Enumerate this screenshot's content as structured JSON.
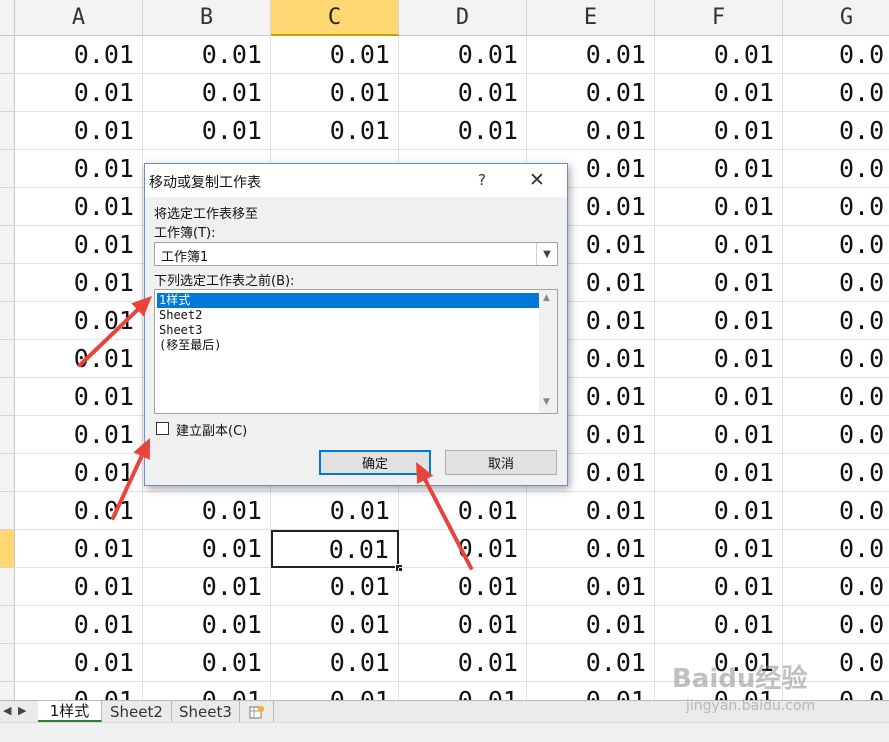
{
  "spreadsheet": {
    "columns": [
      "A",
      "B",
      "C",
      "D",
      "E",
      "F",
      "G"
    ],
    "active_column": "C",
    "active_row_index": 13,
    "cell_values": [
      [
        "0.01",
        "0.01",
        "0.01",
        "0.01",
        "0.01",
        "0.01",
        "0.0"
      ],
      [
        "0.01",
        "0.01",
        "0.01",
        "0.01",
        "0.01",
        "0.01",
        "0.0"
      ],
      [
        "0.01",
        "0.01",
        "0.01",
        "0.01",
        "0.01",
        "0.01",
        "0.0"
      ],
      [
        "0.01",
        "",
        "",
        "",
        "0.01",
        "0.01",
        "0.0"
      ],
      [
        "0.01",
        "",
        "",
        "",
        "0.01",
        "0.01",
        "0.0"
      ],
      [
        "0.01",
        "",
        "",
        "",
        "0.01",
        "0.01",
        "0.0"
      ],
      [
        "0.01",
        "",
        "",
        "",
        "0.01",
        "0.01",
        "0.0"
      ],
      [
        "0.01",
        "",
        "",
        "",
        "0.01",
        "0.01",
        "0.0"
      ],
      [
        "0.01",
        "",
        "",
        "",
        "0.01",
        "0.01",
        "0.0"
      ],
      [
        "0.01",
        "",
        "",
        "",
        "0.01",
        "0.01",
        "0.0"
      ],
      [
        "0.01",
        "",
        "",
        "",
        "0.01",
        "0.01",
        "0.0"
      ],
      [
        "0.01",
        "",
        "",
        "",
        "0.01",
        "0.01",
        "0.0"
      ],
      [
        "0.01",
        "0.01",
        "0.01",
        "0.01",
        "0.01",
        "0.01",
        "0.0"
      ],
      [
        "0.01",
        "0.01",
        "0.01",
        "0.01",
        "0.01",
        "0.01",
        "0.0"
      ],
      [
        "0.01",
        "0.01",
        "0.01",
        "0.01",
        "0.01",
        "0.01",
        "0.0"
      ],
      [
        "0.01",
        "0.01",
        "0.01",
        "0.01",
        "0.01",
        "0.01",
        "0.0"
      ],
      [
        "0.01",
        "0.01",
        "0.01",
        "0.01",
        "0.01",
        "0.01",
        "0.0"
      ],
      [
        "0.01",
        "0.01",
        "0.01",
        "0.01",
        "0.01",
        "0.01",
        "0.0"
      ]
    ]
  },
  "sheet_tabs": {
    "tabs": [
      "1样式",
      "Sheet2",
      "Sheet3"
    ],
    "active": "1样式",
    "new_sheet_icon": "insert-worksheet-icon"
  },
  "dialog": {
    "title": "移动或复制工作表",
    "help_label": "?",
    "close_label": "✕",
    "move_to_label": "将选定工作表移至",
    "workbook_label": "工作簿(T):",
    "workbook_value": "工作簿1",
    "before_sheet_label": "下列选定工作表之前(B):",
    "sheet_options": [
      "1样式",
      "Sheet2",
      "Sheet3",
      "(移至最后)"
    ],
    "selected_option": "1样式",
    "create_copy_label": "建立副本(C)",
    "create_copy_checked": false,
    "ok_label": "确定",
    "cancel_label": "取消"
  },
  "annotations": {
    "arrow_color": "#e8443c"
  },
  "watermark": {
    "logo": "Baidu经验",
    "url": "jingyan.baidu.com"
  },
  "colors": {
    "header_bg": "#f3f3f3",
    "active_header_bg": "#ffd873",
    "selection_blue": "#0078d7",
    "dialog_bg": "#f0f0f0"
  }
}
